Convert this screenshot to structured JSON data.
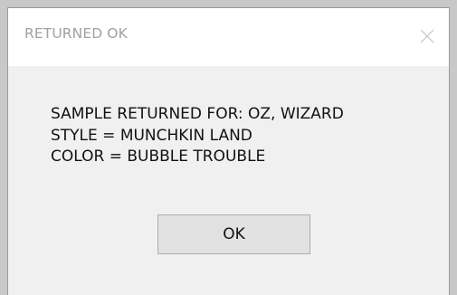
{
  "dialog": {
    "title": "RETURNED OK",
    "close_icon": "close-icon",
    "message_lines": [
      "SAMPLE RETURNED FOR: OZ, WIZARD",
      "STYLE = MUNCHKIN LAND",
      "COLOR = BUBBLE TROUBLE"
    ],
    "ok_label": "OK"
  },
  "colors": {
    "title_text": "#a0a0a0",
    "dialog_body": "#f0f0f0",
    "titlebar": "#ffffff",
    "button_face": "#e1e1e1",
    "button_border": "#adadad"
  }
}
